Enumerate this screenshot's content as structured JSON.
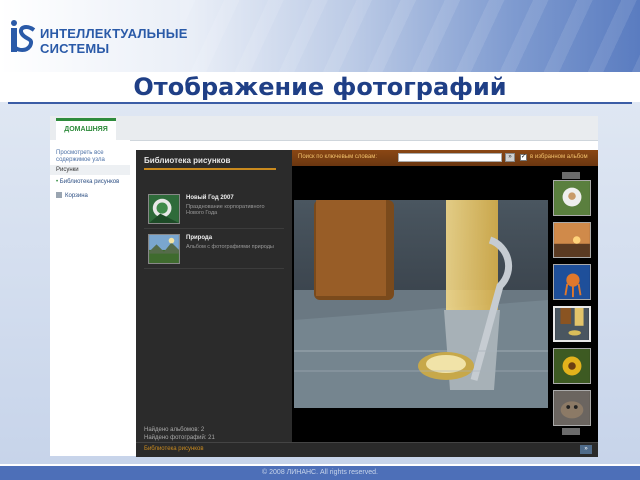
{
  "logo": {
    "line1": "ИНТЕЛЛЕКТУАЛЬНЫЕ",
    "line2": "СИСТЕМЫ"
  },
  "slide": {
    "title": "Отображение фотографий"
  },
  "tabs": {
    "home": "ДОМАШНЯЯ"
  },
  "sidebar": {
    "view_all": "Просмотреть все содержимое узла",
    "section": "Рисунки",
    "library_link": "Библиотека рисунков",
    "trash": "Корзина"
  },
  "library": {
    "title": "Библиотека рисунков",
    "albums": [
      {
        "name": "Новый Год 2007",
        "desc": "Празднование корпоративного Нового Года"
      },
      {
        "name": "Природа",
        "desc": "Альбом с фотографиями природы"
      }
    ],
    "stats": {
      "albums": "Найдено альбомов: 2",
      "photos": "Найдено фотографий: 21"
    }
  },
  "viewer": {
    "search_label": "Поиск по ключевым словам:",
    "search_value": "",
    "go_label": "»",
    "favorites_label": "в избранном альбом",
    "favorites_checked": true
  },
  "footer": {
    "label": "Библиотека рисунков",
    "button": "»"
  },
  "copyright": "© 2008 ЛИНАНС. All rights reserved.",
  "colors": {
    "title": "#1f3f86",
    "accent_orange": "#c98a1e",
    "accent_green": "#2e8b3c",
    "search_bar": "#7b3f12"
  }
}
